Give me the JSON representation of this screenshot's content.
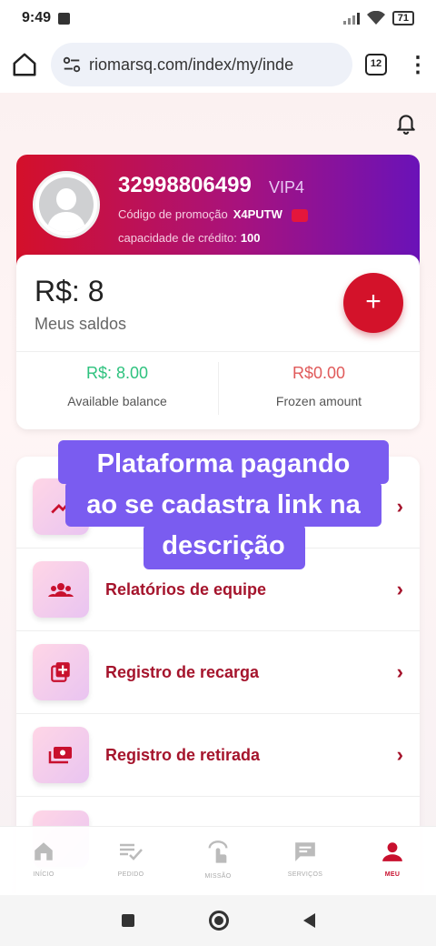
{
  "status_bar": {
    "time": "9:49",
    "battery": "71"
  },
  "browser": {
    "url": "riomarsq.com/index/my/inde",
    "tab_count": "12",
    "menu_label": "⋮"
  },
  "profile": {
    "user_id": "32998806499",
    "vip_level": "VIP4",
    "promo_label": "Código de promoção",
    "promo_code": "X4PUTW",
    "credit_label": "capacidade de crédito:",
    "credit_value": "100"
  },
  "balance": {
    "amount": "R$: 8",
    "label": "Meus saldos",
    "add_label": "+",
    "available_value": "R$: 8.00",
    "available_label": "Available balance",
    "frozen_value": "R$0.00",
    "frozen_label": "Frozen amount"
  },
  "menu": {
    "chevron": "›",
    "items": [
      {
        "label": ""
      },
      {
        "label": "Relatórios de equipe"
      },
      {
        "label": "Registro de recarga"
      },
      {
        "label": "Registro de retirada"
      }
    ]
  },
  "overlay": {
    "line1": "Plataforma pagando",
    "line2": "ao se cadastra link na",
    "line3": "descrição"
  },
  "bottom_nav": [
    {
      "label": "INÍCIO",
      "icon": "home-icon"
    },
    {
      "label": "PEDIDO",
      "icon": "order-icon"
    },
    {
      "label": "MISSÃO",
      "icon": "mission-icon"
    },
    {
      "label": "SERVIÇOS",
      "icon": "chat-icon"
    },
    {
      "label": "MEU",
      "icon": "person-icon",
      "active": true
    }
  ],
  "colors": {
    "primary": "#c8102e",
    "card_gradient": [
      "#d4102a",
      "#6a12b8"
    ],
    "available_green": "#2ec27e",
    "frozen_red": "#e05a5a",
    "overlay_purple": "#7a5cf0"
  }
}
